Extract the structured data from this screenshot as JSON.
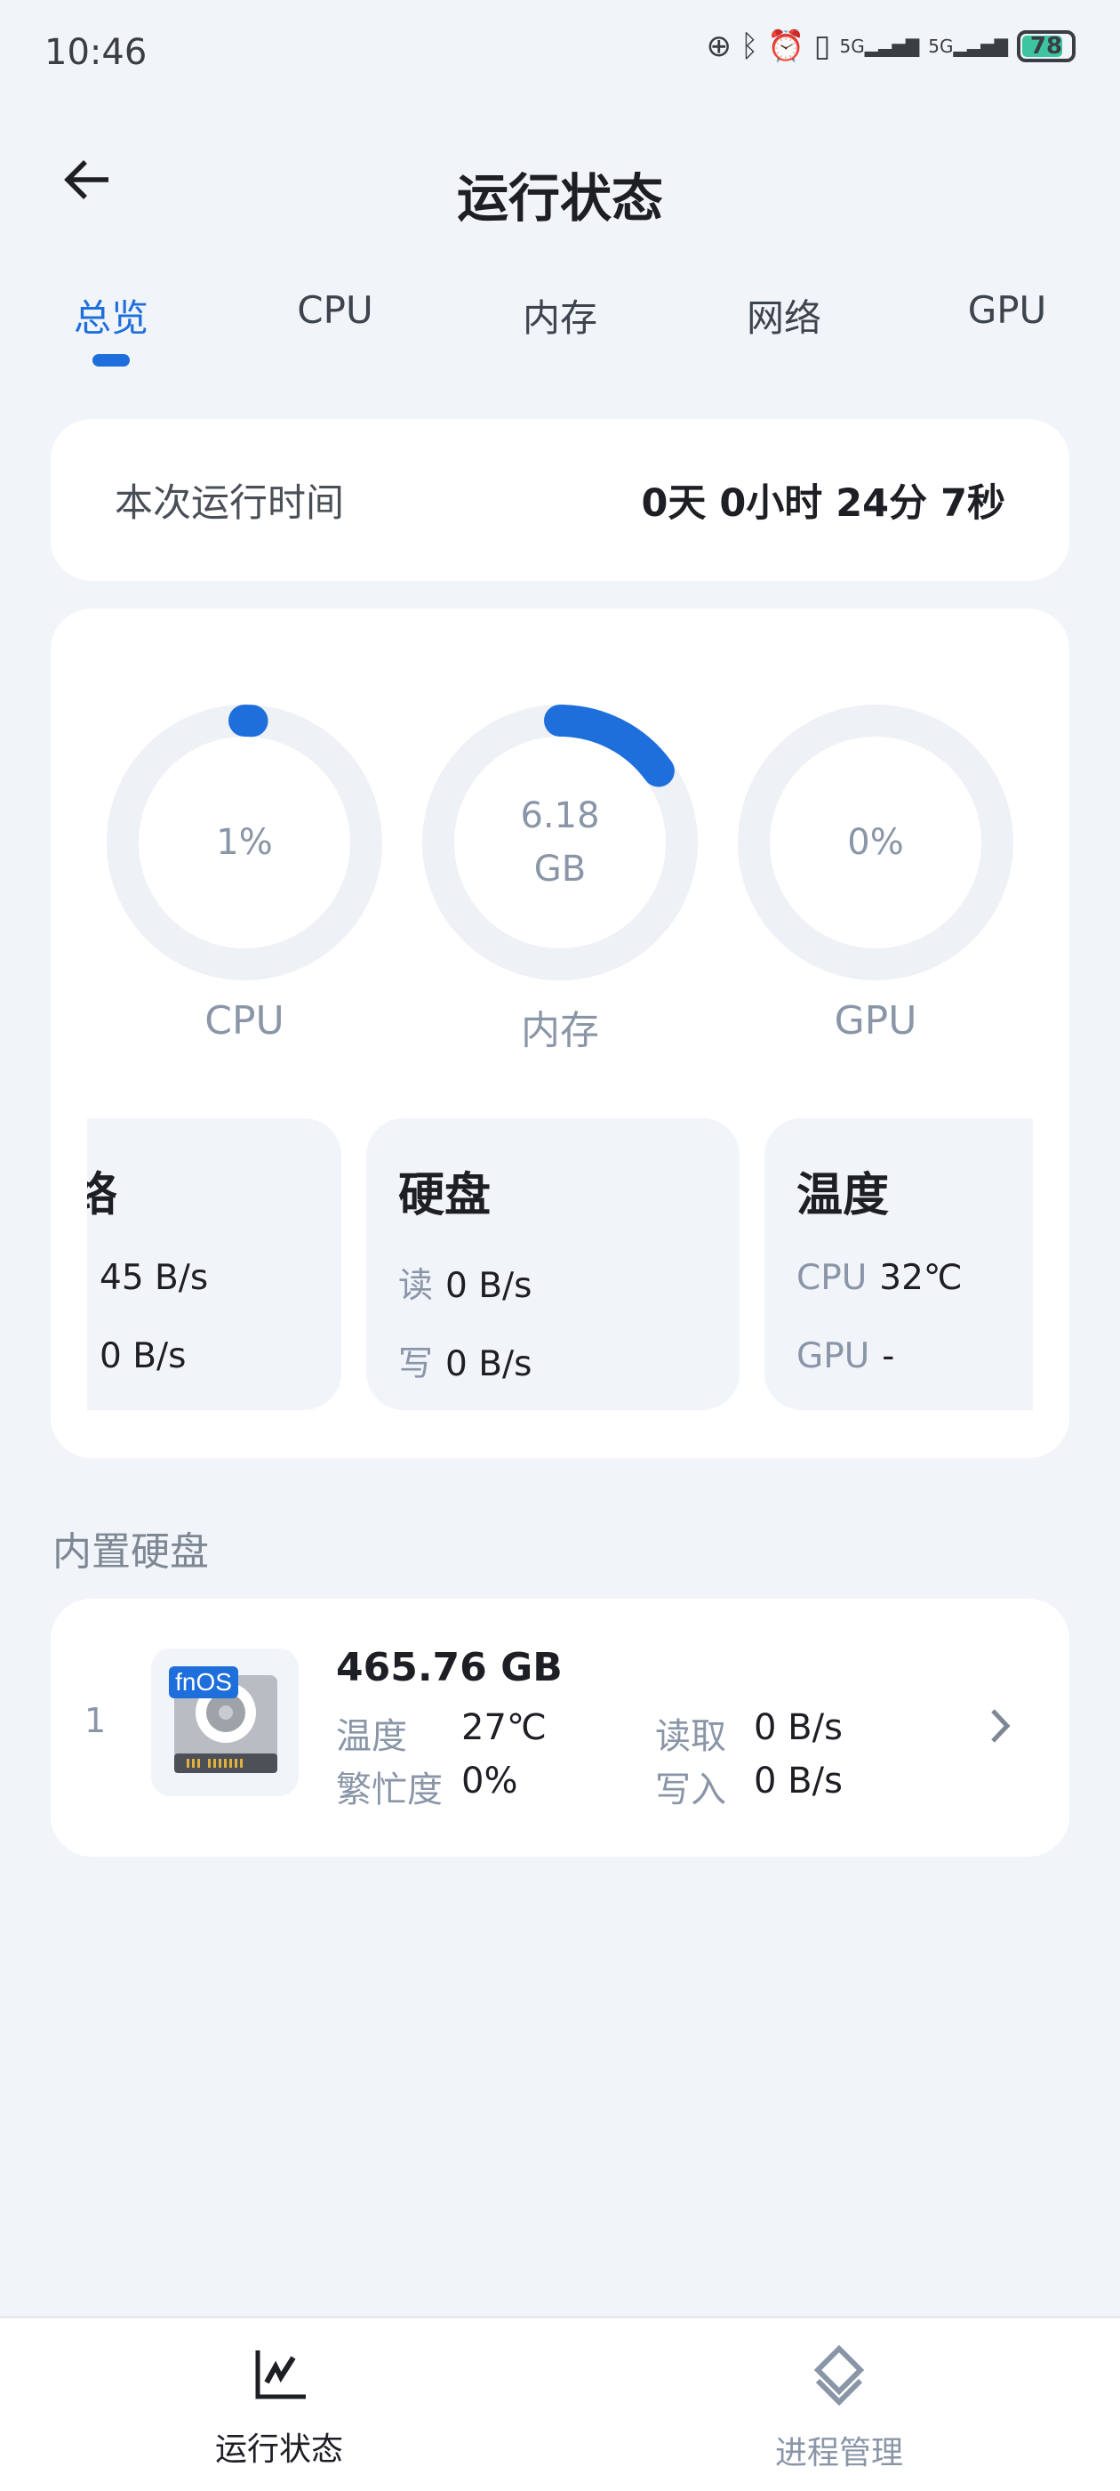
{
  "status_bar": {
    "time": "10:46",
    "network_1": "5G",
    "network_2": "5G",
    "battery": "78",
    "icons": [
      "data-saver-icon",
      "bluetooth-icon",
      "alarm-icon",
      "vibrate-icon",
      "signal-icon",
      "signal-icon",
      "battery-icon"
    ]
  },
  "header": {
    "title": "运行状态",
    "back_icon": "arrow-left-icon"
  },
  "tabs": [
    {
      "label": "总览",
      "active": true
    },
    {
      "label": "CPU"
    },
    {
      "label": "内存"
    },
    {
      "label": "网络"
    },
    {
      "label": "GPU"
    }
  ],
  "uptime": {
    "label": "本次运行时间",
    "value": "0天 0小时 24分 7秒"
  },
  "gauges": [
    {
      "label": "CPU",
      "value": "1%",
      "unit": "",
      "percent": 1
    },
    {
      "label": "内存",
      "value": "6.18",
      "unit": "GB",
      "percent": 15
    },
    {
      "label": "GPU",
      "value": "0%",
      "unit": "",
      "percent": 0
    }
  ],
  "sub_cards": [
    {
      "title": "网络",
      "rows": [
        {
          "k": "",
          "v": "45 B/s"
        },
        {
          "k": "",
          "v": "0 B/s"
        }
      ]
    },
    {
      "title": "硬盘",
      "rows": [
        {
          "k": "读",
          "v": "0 B/s"
        },
        {
          "k": "写",
          "v": "0 B/s"
        }
      ]
    },
    {
      "title": "温度",
      "rows": [
        {
          "k": "CPU",
          "v": "32℃"
        },
        {
          "k": "GPU",
          "v": "-"
        }
      ]
    }
  ],
  "section_title": "内置硬盘",
  "disk": {
    "index": "1",
    "badge": "fnOS",
    "capacity": "465.76 GB",
    "temp_label": "温度",
    "temp": "27℃",
    "busy_label": "繁忙度",
    "busy": "0%",
    "read_label": "读取",
    "read": "0 B/s",
    "write_label": "写入",
    "write": "0 B/s"
  },
  "bottom_nav": [
    {
      "label": "运行状态",
      "icon": "chart-line-icon",
      "active": true
    },
    {
      "label": "进程管理",
      "icon": "layers-icon"
    }
  ],
  "colors": {
    "accent": "#1e6fdc",
    "background": "#f1f4f9",
    "ring_track": "#eef1f5",
    "muted": "#8a96a8"
  }
}
